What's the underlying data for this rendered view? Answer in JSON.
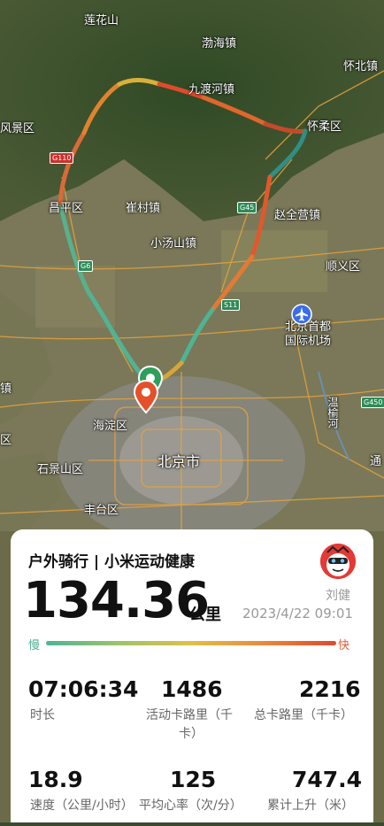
{
  "map": {
    "labels": {
      "lianhuashan": "莲花山",
      "bohaizhen": "渤海镇",
      "huaibeizhen": "怀北镇",
      "jiuduhezhen": "九渡河镇",
      "huairouqu": "怀柔区",
      "fengjingqu": "风景区",
      "cuicunzhen": "崔村镇",
      "changpingqu": "昌平区",
      "zhaoquanyingzhen": "赵全营镇",
      "xiaotangshanzhen": "小汤山镇",
      "shunyiqu": "顺义区",
      "airport": "北京首都\n国际机场",
      "wenyuhe": "温榆河",
      "haidianqu": "海淀区",
      "beijingshi": "北京市",
      "shijingshanqu": "石景山区",
      "fengtaiqu": "丰台区",
      "tong": "通",
      "qu": "区",
      "zhen": "镇"
    },
    "roads": {
      "g110": "G110",
      "g45": "G45",
      "g6": "G6",
      "s11": "S11",
      "g4501": "G450"
    }
  },
  "card": {
    "title": "户外骑行 | 小米运动健康",
    "user_name": "刘健",
    "distance": "134.36",
    "distance_unit": "公里",
    "datetime": "2023/4/22 09:01",
    "legend_slow": "慢",
    "legend_fast": "快",
    "stats": [
      {
        "value": "07:06:34",
        "label": "时长"
      },
      {
        "value": "1486",
        "label_line1": "活动卡路里（千",
        "label_line2": "卡）"
      },
      {
        "value": "2216",
        "label": "总卡路里（千卡）"
      },
      {
        "value": "18.9",
        "label": "速度（公里/小时）"
      },
      {
        "value": "125",
        "label": "平均心率（次/分）"
      },
      {
        "value": "747.4",
        "label": "累计上升（米）"
      }
    ]
  },
  "colors": {
    "slow": "#4fb394",
    "mid": "#e0bf4a",
    "fast": "#e0482c",
    "start_marker": "#2e9e5b",
    "end_marker": "#e5502b"
  }
}
